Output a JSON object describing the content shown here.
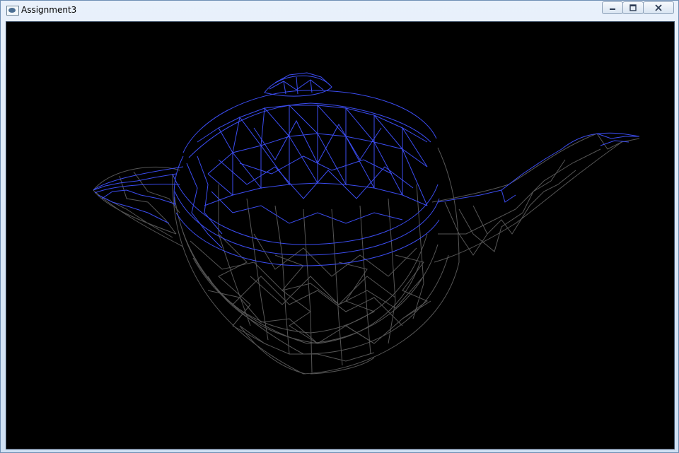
{
  "window": {
    "title": "Assignment3"
  },
  "controls": {
    "minimize": "minimize",
    "maximize": "maximize",
    "close": "close"
  },
  "scene": {
    "object": "teapot",
    "render_mode": "wireframe",
    "background_color": "#000000",
    "front_wire_color": "#3b4cf0",
    "back_wire_color": "#5b5b5b"
  }
}
